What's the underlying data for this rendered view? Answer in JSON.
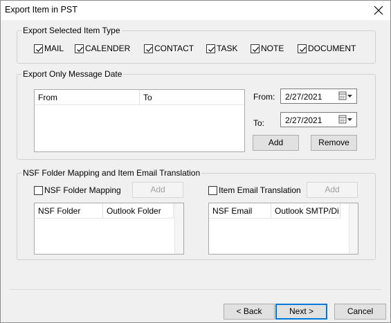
{
  "window": {
    "title": "Export Item in PST",
    "close_label": "×"
  },
  "item_type_group": {
    "legend": "Export Selected Item Type",
    "items": [
      {
        "label": "MAIL",
        "checked": true
      },
      {
        "label": "CALENDER",
        "checked": true
      },
      {
        "label": "CONTACT",
        "checked": true
      },
      {
        "label": "TASK",
        "checked": true
      },
      {
        "label": "NOTE",
        "checked": true
      },
      {
        "label": "DOCUMENT",
        "checked": true
      }
    ]
  },
  "date_group": {
    "legend": "Export Only Message Date",
    "list_columns": [
      "From",
      "To"
    ],
    "from_label": "From:",
    "to_label": "To:",
    "from_value": "2/27/2021",
    "to_value": "2/27/2021",
    "add_label": "Add",
    "remove_label": "Remove"
  },
  "nsf_group": {
    "legend": "NSF Folder Mapping and Item Email Translation",
    "folder_mapping_label": "NSF Folder Mapping",
    "folder_mapping_checked": false,
    "folder_add_label": "Add",
    "folder_columns": [
      "NSF Folder",
      "Outlook Folder"
    ],
    "email_translation_label": "Item Email Translation",
    "email_translation_checked": false,
    "email_add_label": "Add",
    "email_columns": [
      "NSF Email",
      "Outlook SMTP/Di..."
    ]
  },
  "footer": {
    "back_label": "< Back",
    "next_label": "Next >",
    "cancel_label": "Cancel"
  }
}
